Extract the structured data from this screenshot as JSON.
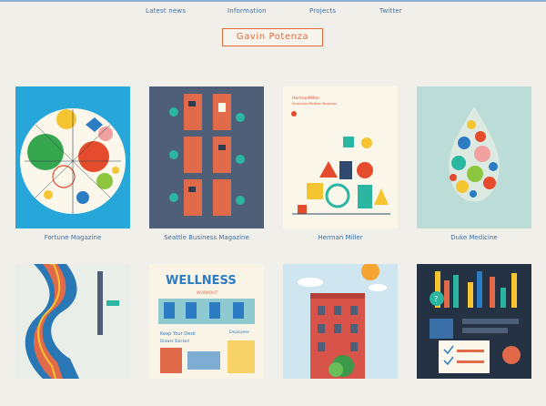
{
  "nav": {
    "items": [
      {
        "label": "Latest news"
      },
      {
        "label": "Information"
      },
      {
        "label": "Projects"
      },
      {
        "label": "Twitter"
      }
    ]
  },
  "logo": {
    "text": "Gavin Potenza"
  },
  "projects": [
    {
      "caption": "Fortune Magazine"
    },
    {
      "caption": "Seattle Business Magazine"
    },
    {
      "caption": "Herman Miller"
    },
    {
      "caption": "Duke Medicine"
    }
  ],
  "second_row_text": {
    "wellness_title": "WELLNESS",
    "workout": "WORKOUT",
    "keep_desk": "Keep Your Desk",
    "clutter": "Drawer Stocked",
    "employees": "Employees"
  },
  "herman_cover": {
    "title": "HermanMiller",
    "subtitle": "Small and Medium Business"
  },
  "colors": {
    "link": "#3a6fa8",
    "accent": "#e06a3a",
    "background": "#f1efe9"
  }
}
